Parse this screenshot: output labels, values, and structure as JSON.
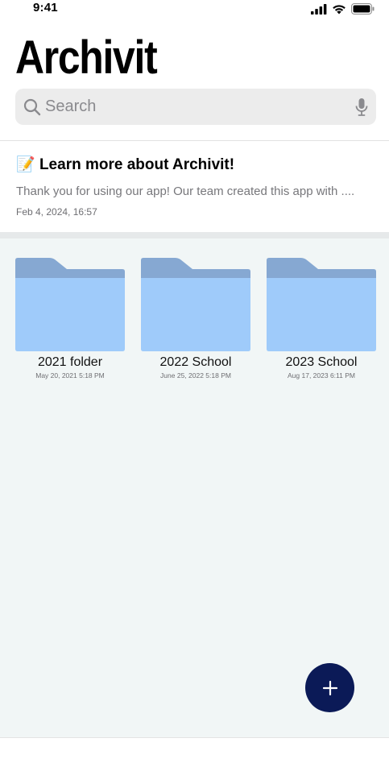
{
  "status_bar": {
    "time": "9:41"
  },
  "app": {
    "title": "Archivit"
  },
  "search": {
    "placeholder": "Search"
  },
  "note": {
    "emoji": "📝",
    "title": "Learn more about Archivit!",
    "body": "Thank you for using our app! Our team created this app with ....",
    "date": "Feb 4, 2024, 16:57"
  },
  "folders": [
    {
      "name": "2021 folder",
      "date": "May 20, 2021 5:18 PM"
    },
    {
      "name": "2022 School",
      "date": "June 25, 2022 5:18 PM"
    },
    {
      "name": "2023 School",
      "date": "Aug 17, 2023 6:11 PM"
    }
  ],
  "colors": {
    "folder_tab": "#86a8d2",
    "folder_body": "#9fcbfa",
    "fab": "#0b1a57",
    "content_bg": "#f1f6f6"
  },
  "icons": {
    "search": "search-icon",
    "mic": "mic-icon",
    "add": "plus-icon",
    "signal": "cellular-signal-icon",
    "wifi": "wifi-icon",
    "battery": "battery-icon"
  }
}
